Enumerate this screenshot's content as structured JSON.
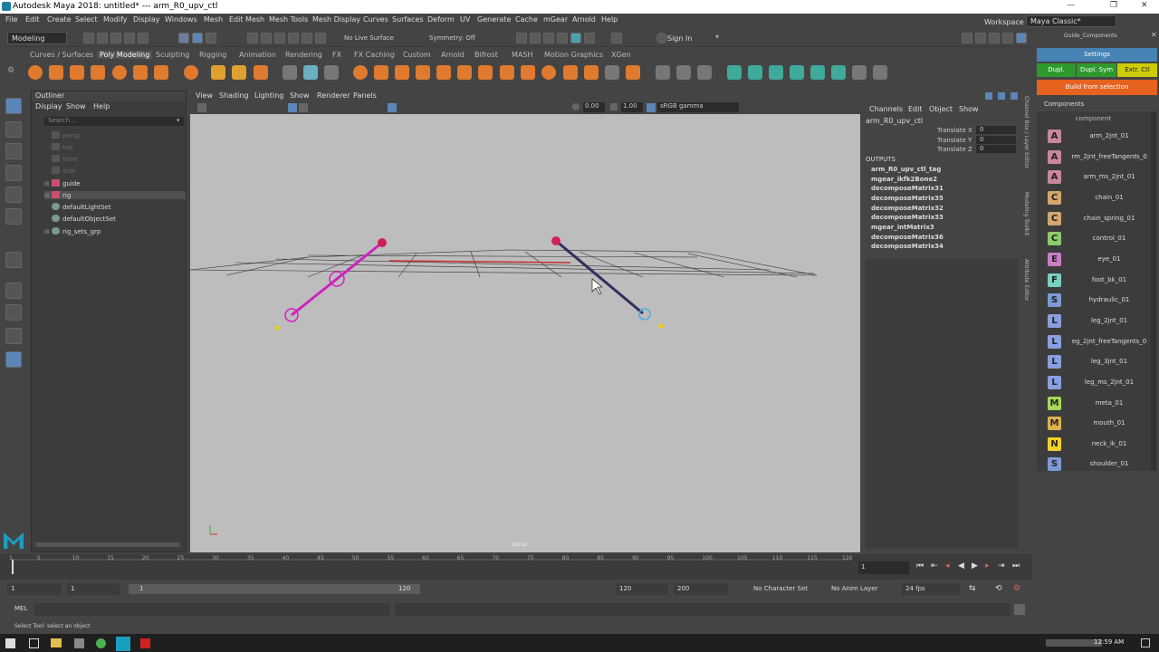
{
  "titlebar": {
    "title": "Autodesk Maya 2018: untitled*   ---   arm_R0_upv_ctl",
    "minimize": "—",
    "maximize": "❐",
    "close": "✕"
  },
  "menubar": [
    "File",
    "Edit",
    "Create",
    "Select",
    "Modify",
    "Display",
    "Windows",
    "Mesh",
    "Edit Mesh",
    "Mesh Tools",
    "Mesh Display",
    "Curves",
    "Surfaces",
    "Deform",
    "UV",
    "Generate",
    "Cache",
    "mGear",
    "Arnold",
    "Help"
  ],
  "workspace": {
    "label": "Workspace :",
    "value": "Maya Classic*"
  },
  "statusline": {
    "mode": "Modeling",
    "live_surface": "No Live Surface",
    "symmetry": "Symmetry: Off",
    "signin": "Sign In"
  },
  "shelf_tabs": [
    "Curves / Surfaces",
    "Poly Modeling",
    "Sculpting",
    "Rigging",
    "Animation",
    "Rendering",
    "FX",
    "FX Caching",
    "Custom",
    "Arnold",
    "Bifrost",
    "MASH",
    "Motion Graphics",
    "XGen"
  ],
  "shelf_active_tab": "Poly Modeling",
  "outliner": {
    "title": "Outliner",
    "menus": [
      "Display",
      "Show",
      "Help"
    ],
    "search_placeholder": "Search...",
    "items": [
      {
        "label": "persp",
        "dim": true,
        "exp": ""
      },
      {
        "label": "top",
        "dim": true,
        "exp": ""
      },
      {
        "label": "front",
        "dim": true,
        "exp": ""
      },
      {
        "label": "side",
        "dim": true,
        "exp": ""
      },
      {
        "label": "guide",
        "dim": false,
        "exp": "⊞"
      },
      {
        "label": "rig",
        "dim": false,
        "exp": "⊞"
      },
      {
        "label": "defaultLightSet",
        "dim": false,
        "exp": ""
      },
      {
        "label": "defaultObjectSet",
        "dim": false,
        "exp": ""
      },
      {
        "label": "rig_sets_grp",
        "dim": false,
        "exp": "⊞"
      }
    ]
  },
  "viewport": {
    "menus": [
      "View",
      "Shading",
      "Lighting",
      "Show",
      "Renderer",
      "Panels"
    ],
    "field1": "0.00",
    "field2": "1.00",
    "colorspace": "sRGB gamma",
    "camera_label": "persp"
  },
  "channelbox": {
    "menus": [
      "Channels",
      "Edit",
      "Object",
      "Show"
    ],
    "object": "arm_R0_upv_ctl",
    "attrs": [
      {
        "name": "Translate X",
        "value": "0"
      },
      {
        "name": "Translate Y",
        "value": "0"
      },
      {
        "name": "Translate Z",
        "value": "0"
      }
    ],
    "outputs_label": "OUTPUTS",
    "outputs": [
      "arm_R0_upv_ctl_tag",
      "mgear_ikfk2Bone2",
      "decomposeMatrix31",
      "decomposeMatrix35",
      "decomposeMatrix32",
      "decomposeMatrix33",
      "mgear_intMatrix3",
      "decomposeMatrix36",
      "decomposeMatrix34"
    ],
    "side_tabs": [
      "Channel Box / Layer Editor",
      "Modeling Toolkit",
      "Attribute Editor"
    ]
  },
  "guide_panel": {
    "title": "Guide_Components",
    "settings": "Settings",
    "dupl": "Dupl.",
    "dupl_sym": "Dupl. Sym",
    "extr_ctl": "Extr. Ctl",
    "build": "Build from selection",
    "components_label": "Components",
    "column_header": "component",
    "components": [
      {
        "letter": "A",
        "name": "arm_2jnt_01",
        "color": "#c9879a"
      },
      {
        "letter": "A",
        "name": "rm_2jnt_freeTangents_0",
        "color": "#c9879a"
      },
      {
        "letter": "A",
        "name": "arm_ms_2jnt_01",
        "color": "#c9879a"
      },
      {
        "letter": "C",
        "name": "chain_01",
        "color": "#d2a66e"
      },
      {
        "letter": "C",
        "name": "chain_spring_01",
        "color": "#d2a66e"
      },
      {
        "letter": "C",
        "name": "control_01",
        "color": "#8ccb6a"
      },
      {
        "letter": "E",
        "name": "eye_01",
        "color": "#c97ec6"
      },
      {
        "letter": "F",
        "name": "foot_bk_01",
        "color": "#7ad0c0"
      },
      {
        "letter": "S",
        "name": "hydraulic_01",
        "color": "#7d9ad6"
      },
      {
        "letter": "L",
        "name": "leg_2jnt_01",
        "color": "#8a9fe0"
      },
      {
        "letter": "L",
        "name": "eg_2jnt_freeTangents_0",
        "color": "#8a9fe0"
      },
      {
        "letter": "L",
        "name": "leg_3jnt_01",
        "color": "#8a9fe0"
      },
      {
        "letter": "L",
        "name": "leg_ms_2jnt_01",
        "color": "#8a9fe0"
      },
      {
        "letter": "M",
        "name": "meta_01",
        "color": "#a6d85a"
      },
      {
        "letter": "M",
        "name": "mouth_01",
        "color": "#e0b24c"
      },
      {
        "letter": "N",
        "name": "neck_ik_01",
        "color": "#f0d22c"
      },
      {
        "letter": "S",
        "name": "shoulder_01",
        "color": "#7d9ad6"
      }
    ]
  },
  "timeslider": {
    "ticks": [
      "1",
      "5",
      "10",
      "15",
      "20",
      "25",
      "30",
      "35",
      "40",
      "45",
      "50",
      "55",
      "60",
      "65",
      "70",
      "75",
      "80",
      "85",
      "90",
      "95",
      "100",
      "105",
      "110",
      "115",
      "120"
    ],
    "current": "1"
  },
  "rangeslider": {
    "start": "1",
    "start2": "1",
    "bar_start": "1",
    "bar_end": "120",
    "end": "120",
    "end2": "200",
    "charset": "No Character Set",
    "animlayer": "No Anim Layer",
    "fps": "24 fps"
  },
  "cmdline": {
    "label": "MEL"
  },
  "helpline": "Select Tool: select an object",
  "taskbar": {
    "time": "12:59 AM"
  }
}
